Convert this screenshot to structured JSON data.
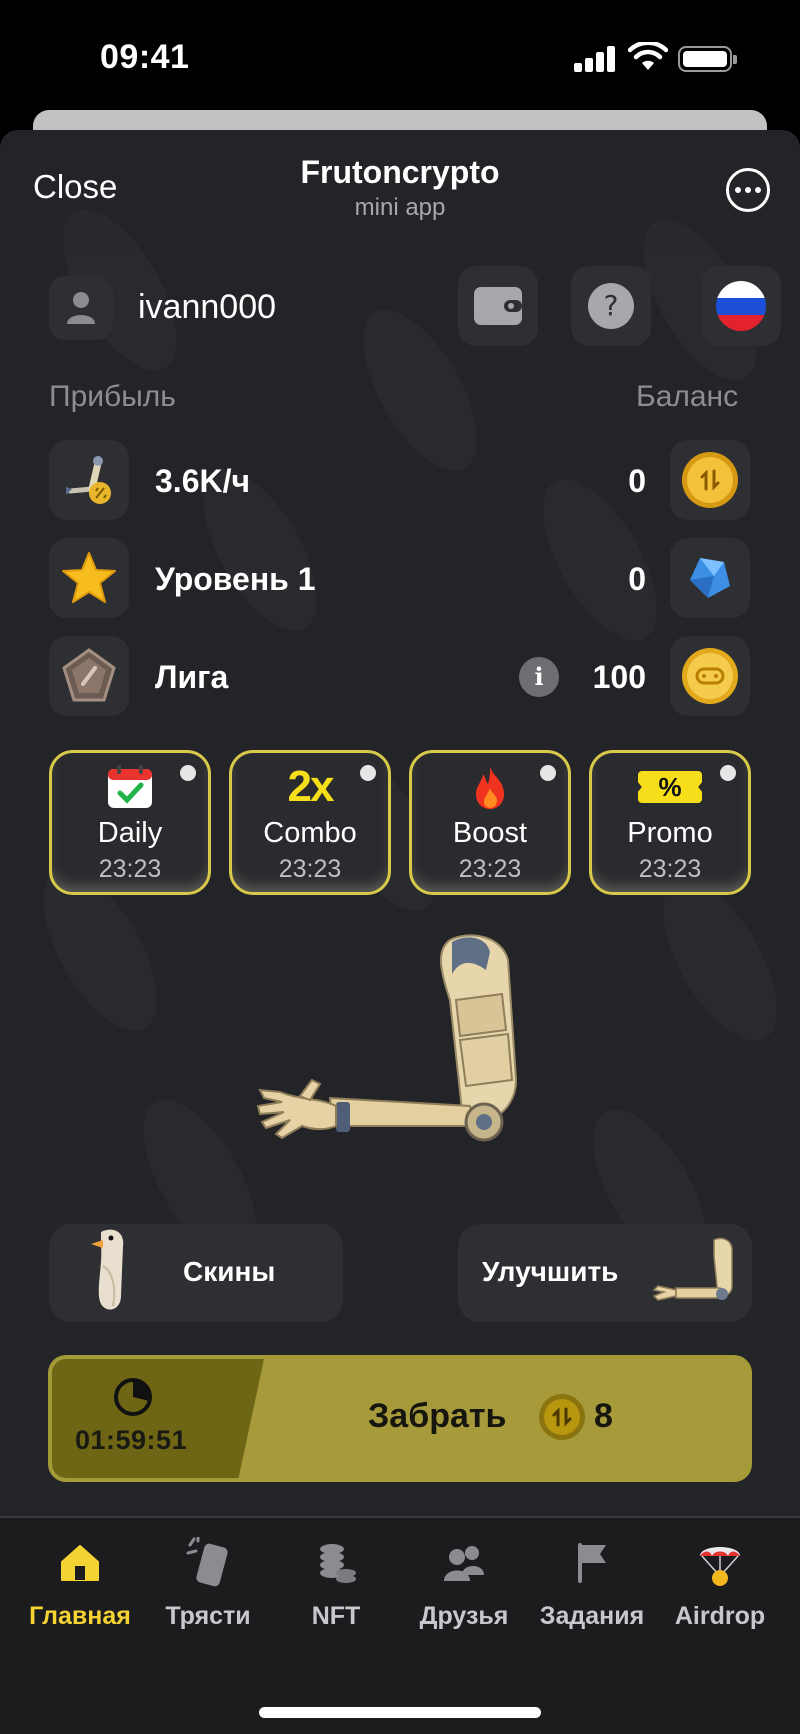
{
  "status_bar": {
    "time": "09:41"
  },
  "header": {
    "close_label": "Close",
    "title": "Frutoncrypto",
    "subtitle": "mini app"
  },
  "user": {
    "name": "ivann000"
  },
  "labels": {
    "profit": "Прибыль",
    "balance": "Баланс"
  },
  "stats": {
    "profit_rate": "3.6K/ч",
    "level": "Уровень 1",
    "league": "Лига",
    "coin_balance": "0",
    "gem_balance": "0",
    "token_balance": "100"
  },
  "cards": [
    {
      "name": "Daily",
      "timer": "23:23",
      "icon": "calendar-check-icon"
    },
    {
      "name": "Combo",
      "timer": "23:23",
      "icon": "combo-2x-icon",
      "icon_text": "2x"
    },
    {
      "name": "Boost",
      "timer": "23:23",
      "icon": "fire-icon"
    },
    {
      "name": "Promo",
      "timer": "23:23",
      "icon": "ticket-percent-icon",
      "icon_text": "%"
    }
  ],
  "actions": {
    "skins": "Скины",
    "upgrade": "Улучшить"
  },
  "claim": {
    "timer": "01:59:51",
    "label": "Забрать",
    "amount": "8"
  },
  "nav": [
    {
      "label": "Главная",
      "icon": "home-icon",
      "active": true
    },
    {
      "label": "Трясти",
      "icon": "shake-phone-icon",
      "active": false
    },
    {
      "label": "NFT",
      "icon": "coin-stack-icon",
      "active": false
    },
    {
      "label": "Друзья",
      "icon": "friends-icon",
      "active": false
    },
    {
      "label": "Задания",
      "icon": "flag-icon",
      "active": false
    },
    {
      "label": "Airdrop",
      "icon": "parachute-icon",
      "active": false
    }
  ],
  "colors": {
    "accent": "#f4d332",
    "card_border": "#d9c94a",
    "claim_bg": "#a69a3a",
    "claim_dark": "#6e6614",
    "background": "#232427"
  }
}
